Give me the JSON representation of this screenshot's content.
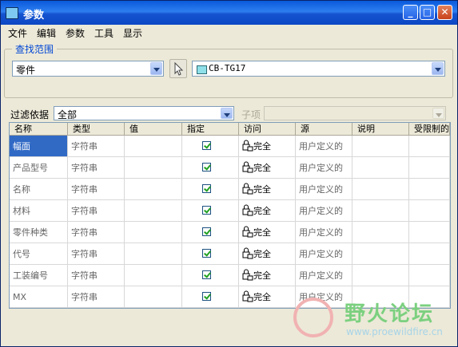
{
  "window": {
    "title": "参数",
    "controls": {
      "minimize_icon": "minimize-icon",
      "maximize_icon": "maximize-icon",
      "close_icon": "close-icon"
    }
  },
  "menu": [
    "文件",
    "编辑",
    "参数",
    "工具",
    "显示"
  ],
  "search": {
    "group_title": "查找范围",
    "scope_value": "零件",
    "target_value": "CB-TG17"
  },
  "filter": {
    "label": "过滤依据",
    "value": "全部",
    "subitem_label": "子项",
    "subitem_value": ""
  },
  "table": {
    "columns": [
      "名称",
      "类型",
      "值",
      "指定",
      "访问",
      "源",
      "说明",
      "受限制的"
    ],
    "rows": [
      {
        "name": "幅面",
        "type": "字符串",
        "value": "",
        "designated": true,
        "access": "完全",
        "source": "用户定义的",
        "desc": "",
        "restricted": ""
      },
      {
        "name": "产品型号",
        "type": "字符串",
        "value": "",
        "designated": true,
        "access": "完全",
        "source": "用户定义的",
        "desc": "",
        "restricted": ""
      },
      {
        "name": "名称",
        "type": "字符串",
        "value": "",
        "designated": true,
        "access": "完全",
        "source": "用户定义的",
        "desc": "",
        "restricted": ""
      },
      {
        "name": "材料",
        "type": "字符串",
        "value": "",
        "designated": true,
        "access": "完全",
        "source": "用户定义的",
        "desc": "",
        "restricted": ""
      },
      {
        "name": "零件种类",
        "type": "字符串",
        "value": "",
        "designated": true,
        "access": "完全",
        "source": "用户定义的",
        "desc": "",
        "restricted": ""
      },
      {
        "name": "代号",
        "type": "字符串",
        "value": "",
        "designated": true,
        "access": "完全",
        "source": "用户定义的",
        "desc": "",
        "restricted": ""
      },
      {
        "name": "工装编号",
        "type": "字符串",
        "value": "",
        "designated": true,
        "access": "完全",
        "source": "用户定义的",
        "desc": "",
        "restricted": ""
      },
      {
        "name": "MX",
        "type": "字符串",
        "value": "",
        "designated": true,
        "access": "完全",
        "source": "用户定义的",
        "desc": "",
        "restricted": ""
      }
    ]
  },
  "watermark": {
    "title": "野火论坛",
    "url": "www.proewildfire.cn"
  }
}
